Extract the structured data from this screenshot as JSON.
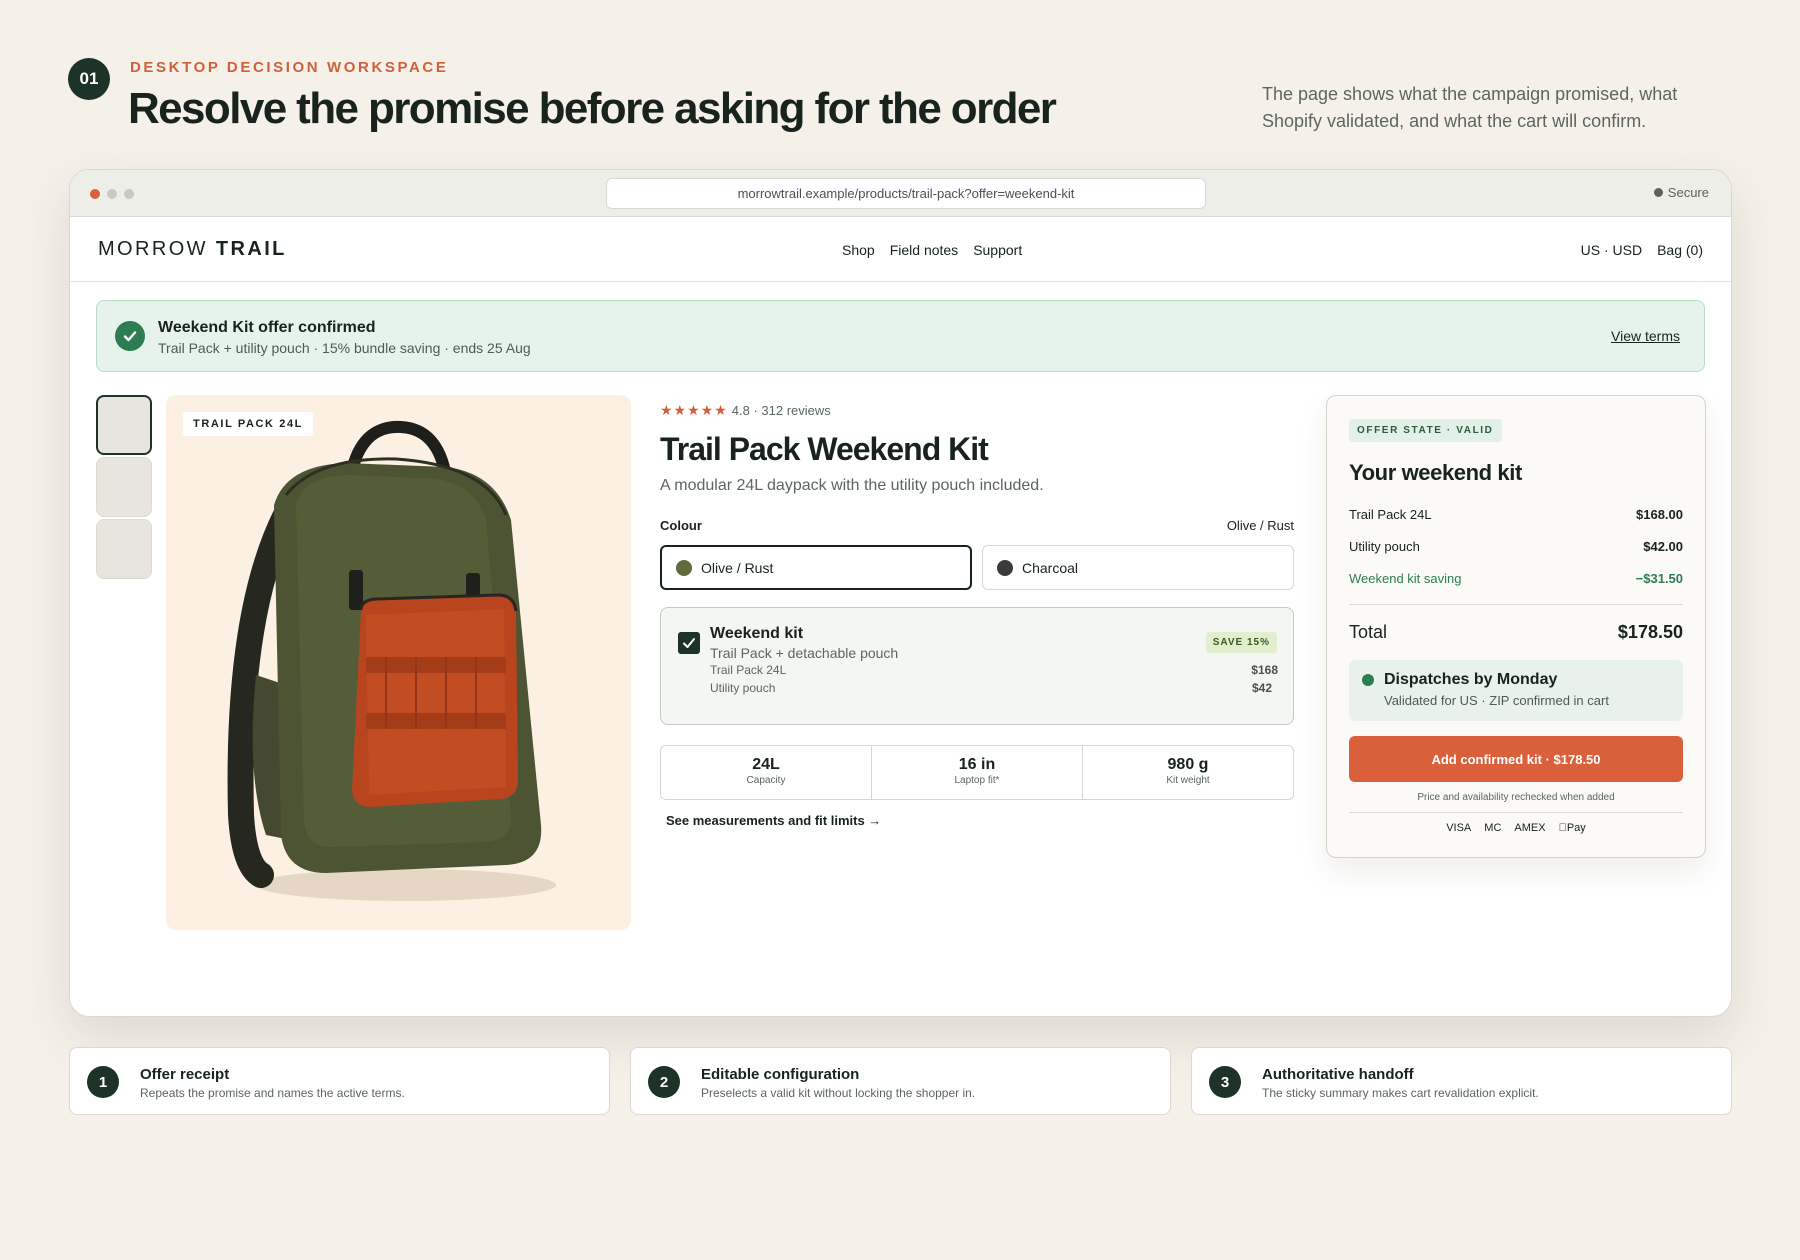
{
  "page": {
    "step": "01",
    "eyebrow": "DESKTOP DECISION WORKSPACE",
    "headline": "Resolve the promise before asking for the order",
    "description": "The page shows what the campaign promised, what Shopify validated, and what the cart will confirm."
  },
  "browser": {
    "url": "morrowtrail.example/products/trail-pack?offer=weekend-kit",
    "secure_label": "Secure"
  },
  "store": {
    "brand_light": "MORROW",
    "brand_bold": "TRAIL",
    "nav": [
      "Shop",
      "Field notes",
      "Support"
    ],
    "locale": "US · USD",
    "bag": "Bag (0)"
  },
  "banner": {
    "title": "Weekend Kit offer confirmed",
    "subtitle": "Trail Pack + utility pouch · 15% bundle saving · ends 25 Aug",
    "link": "View terms"
  },
  "gallery": {
    "tag": "TRAIL PACK 24L",
    "thumbnail_count": 3
  },
  "product": {
    "stars": "★★★★★",
    "rating": "4.8 · 312 reviews",
    "title": "Trail Pack Weekend Kit",
    "subtitle": "A modular 24L daypack with the utility pouch included.",
    "colour_label": "Colour",
    "colour_selected": "Olive / Rust",
    "colours": [
      {
        "name": "Olive / Rust",
        "swatch": "#5f6a3d"
      },
      {
        "name": "Charcoal",
        "swatch": "#3a3b3c"
      }
    ],
    "kit": {
      "title": "Weekend kit",
      "subtitle": "Trail Pack + detachable pouch",
      "badge": "SAVE 15%",
      "items": [
        {
          "name": "Trail Pack 24L",
          "price": "$168"
        },
        {
          "name": "Utility pouch",
          "price": "$42"
        }
      ]
    },
    "specs": [
      {
        "value": "24L",
        "label": "Capacity"
      },
      {
        "value": "16 in",
        "label": "Laptop fit*"
      },
      {
        "value": "980 g",
        "label": "Kit weight"
      }
    ],
    "measure_link": "See measurements and fit limits →"
  },
  "summary": {
    "state_badge": "OFFER STATE · VALID",
    "title": "Your weekend kit",
    "lines": [
      {
        "label": "Trail Pack 24L",
        "amount": "$168.00"
      },
      {
        "label": "Utility pouch",
        "amount": "$42.00"
      },
      {
        "label": "Weekend kit saving",
        "amount": "−$31.50"
      }
    ],
    "total_label": "Total",
    "total": "$178.50",
    "dispatch_title": "Dispatches by Monday",
    "dispatch_sub": "Validated for US · ZIP confirmed in cart",
    "cta": "Add confirmed kit · $178.50",
    "recheck": "Price and availability rechecked when added",
    "payments": [
      "VISA",
      "MC",
      "AMEX",
      "Pay"
    ]
  },
  "footer": [
    {
      "num": "1",
      "title": "Offer receipt",
      "desc": "Repeats the promise and names the active terms."
    },
    {
      "num": "2",
      "title": "Editable configuration",
      "desc": "Preselects a valid kit without locking the shopper in."
    },
    {
      "num": "3",
      "title": "Authoritative handoff",
      "desc": "The sticky summary makes cart revalidation explicit."
    }
  ],
  "colors": {
    "accent": "#d9603b",
    "dark": "#1d3328",
    "success": "#2e7d52",
    "background": "#f5f1e9"
  }
}
